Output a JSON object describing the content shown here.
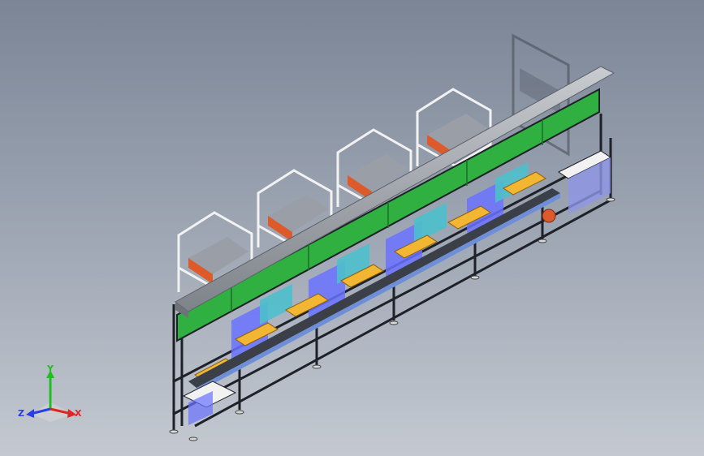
{
  "viewport": {
    "background_top": "#7b8596",
    "background_bottom": "#c4c9d1"
  },
  "assembly": {
    "stations": 5,
    "colors": {
      "frame": "#1e2128",
      "guard_panel": "#2fb040",
      "rail": "#9ea3a9",
      "hopper_frame": "#f2f2f2",
      "hopper_tray": "#dd5a2a",
      "fixture": "#f2b632",
      "blue_panel": "#6a72ff",
      "cyan_panel": "#4cc0cc"
    }
  },
  "triad": {
    "x_label": "X",
    "y_label": "Y",
    "z_label": "Z",
    "x_color": "#e52222",
    "y_color": "#1fbf1f",
    "z_color": "#2a3fe0"
  }
}
